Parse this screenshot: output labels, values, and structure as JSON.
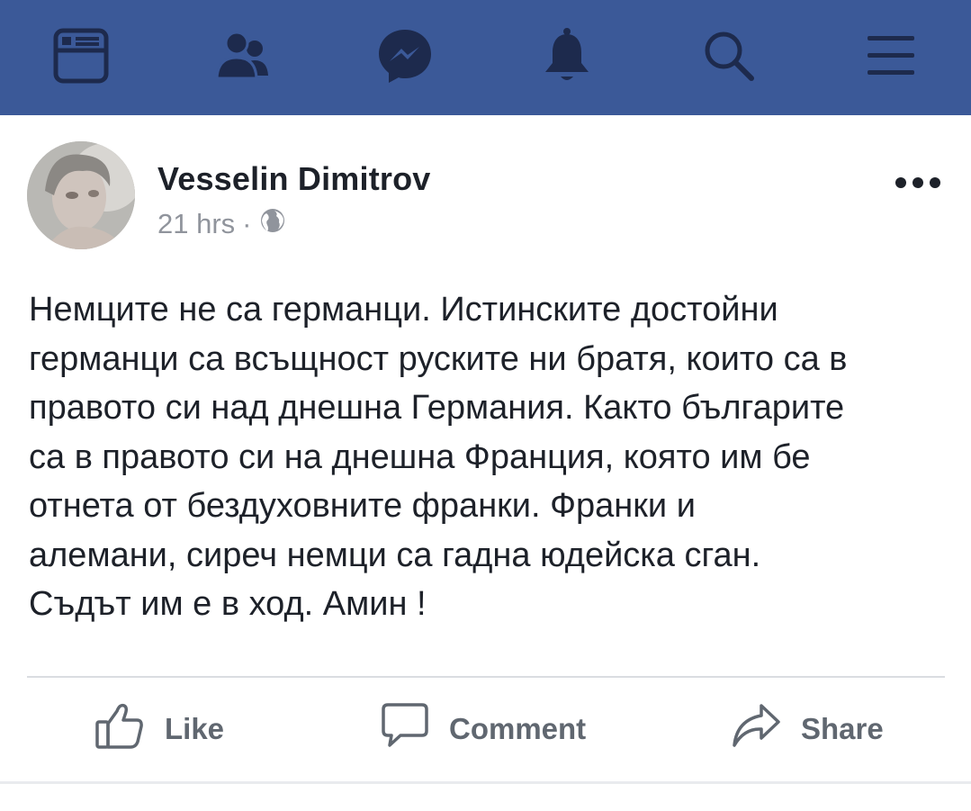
{
  "nav": {
    "items": [
      {
        "name": "news-feed",
        "icon": "news-feed-icon"
      },
      {
        "name": "friends",
        "icon": "friends-icon"
      },
      {
        "name": "messenger",
        "icon": "messenger-icon"
      },
      {
        "name": "notifications",
        "icon": "bell-icon"
      },
      {
        "name": "search",
        "icon": "search-icon"
      },
      {
        "name": "menu",
        "icon": "hamburger-menu-icon"
      }
    ],
    "background": "#3b5998"
  },
  "post": {
    "author": "Vesselin Dimitrov",
    "time": "21 hrs",
    "separator": "·",
    "privacy_icon": "globe-icon",
    "more_icon": "more-options-icon",
    "text_lines": [
      "Немците не са германци. Истинските достойни",
      "германци са всъщност руските ни братя, които са в",
      "правото си над днешна Германия. Както българите",
      "са в правото си на днешна Франция, която им бе",
      "отнета от бездуховните франки. Франки и",
      "алемани, сиреч немци са гадна юдейска сган.",
      "Съдът им е в ход. Амин !"
    ]
  },
  "actions": {
    "like": "Like",
    "comment": "Comment",
    "share": "Share"
  }
}
